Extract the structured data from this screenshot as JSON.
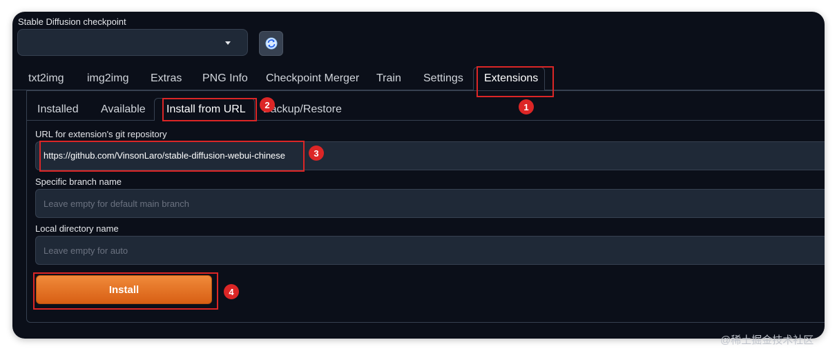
{
  "checkpoint": {
    "label": "Stable Diffusion checkpoint",
    "value": "",
    "dropdown_icon": "caret-down-icon",
    "refresh_icon": "refresh-icon"
  },
  "main_tabs": [
    {
      "label": "txt2img",
      "active": false
    },
    {
      "label": "img2img",
      "active": false
    },
    {
      "label": "Extras",
      "active": false
    },
    {
      "label": "PNG Info",
      "active": false
    },
    {
      "label": "Checkpoint Merger",
      "active": false
    },
    {
      "label": "Train",
      "active": false
    },
    {
      "label": "Settings",
      "active": false
    },
    {
      "label": "Extensions",
      "active": true
    }
  ],
  "sub_tabs": [
    {
      "label": "Installed",
      "active": false
    },
    {
      "label": "Available",
      "active": false
    },
    {
      "label": "Install from URL",
      "active": true
    },
    {
      "label": "Backup/Restore",
      "active": false
    }
  ],
  "form": {
    "url": {
      "label": "URL for extension's git repository",
      "value": "https://github.com/VinsonLaro/stable-diffusion-webui-chinese"
    },
    "branch": {
      "label": "Specific branch name",
      "placeholder": "Leave empty for default main branch"
    },
    "directory": {
      "label": "Local directory name",
      "placeholder": "Leave empty for auto"
    },
    "install_label": "Install"
  },
  "annotations": [
    "1",
    "2",
    "3",
    "4"
  ],
  "colors": {
    "background": "#0b0f19",
    "input": "#1f2937",
    "border": "#374151",
    "accent": "#e8742a",
    "highlight": "#dc2626"
  },
  "watermark": "@稀土掘金技术社区"
}
